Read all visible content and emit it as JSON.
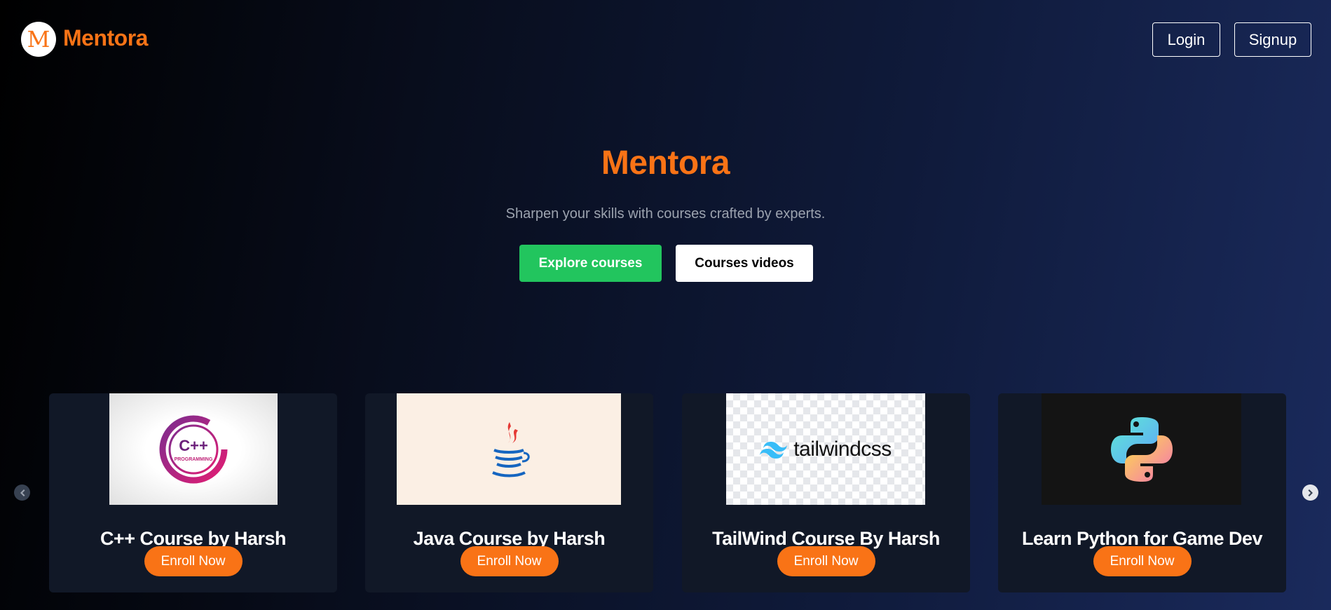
{
  "header": {
    "logo_letter": "M",
    "brand": "Mentora",
    "login_label": "Login",
    "signup_label": "Signup"
  },
  "hero": {
    "title": "Mentora",
    "subtitle": "Sharpen your skills with courses crafted by experts.",
    "explore_label": "Explore courses",
    "videos_label": "Courses videos"
  },
  "courses": [
    {
      "title": "C++ Course by Harsh",
      "enroll_label": "Enroll Now",
      "image_text": "C++",
      "image_subtext": "PROGRAMMING",
      "icon": "cpp-logo-icon"
    },
    {
      "title": "Java Course by Harsh",
      "enroll_label": "Enroll Now",
      "icon": "java-logo-icon"
    },
    {
      "title": "TailWind Course By Harsh",
      "enroll_label": "Enroll Now",
      "image_text": "tailwindcss",
      "icon": "tailwind-logo-icon"
    },
    {
      "title": "Learn Python for Game Dev",
      "enroll_label": "Enroll Now",
      "icon": "python-logo-icon"
    }
  ],
  "carousel": {
    "prev_icon": "chevron-left-icon",
    "next_icon": "chevron-right-icon"
  },
  "colors": {
    "accent": "#f97316",
    "explore": "#22c55e",
    "card": "#111827"
  }
}
